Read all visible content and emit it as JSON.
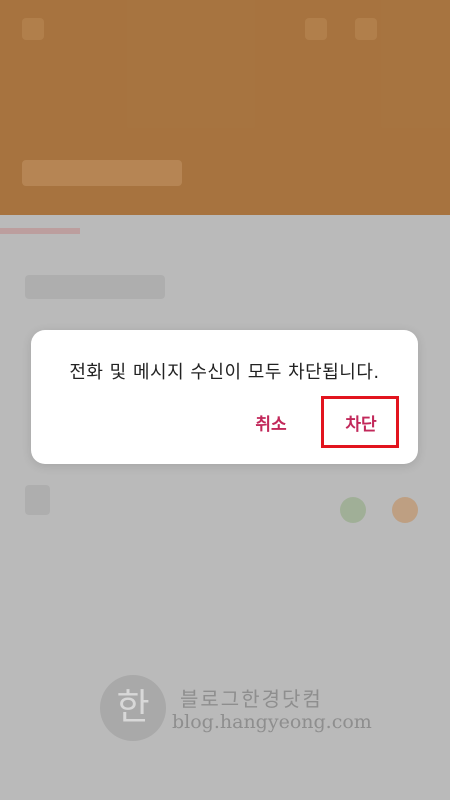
{
  "dialog": {
    "message": "전화 및 메시지 수신이 모두 차단됩니다.",
    "cancel_label": "취소",
    "block_label": "차단"
  },
  "colors": {
    "header": "#b07a43",
    "background": "#c4c4c4",
    "button_text": "#c2285a",
    "highlight_box": "#e2141e"
  },
  "watermark": {
    "logo_glyph": "한",
    "title": "블로그한경닷컴",
    "url": "blog.hangyeong.com"
  }
}
